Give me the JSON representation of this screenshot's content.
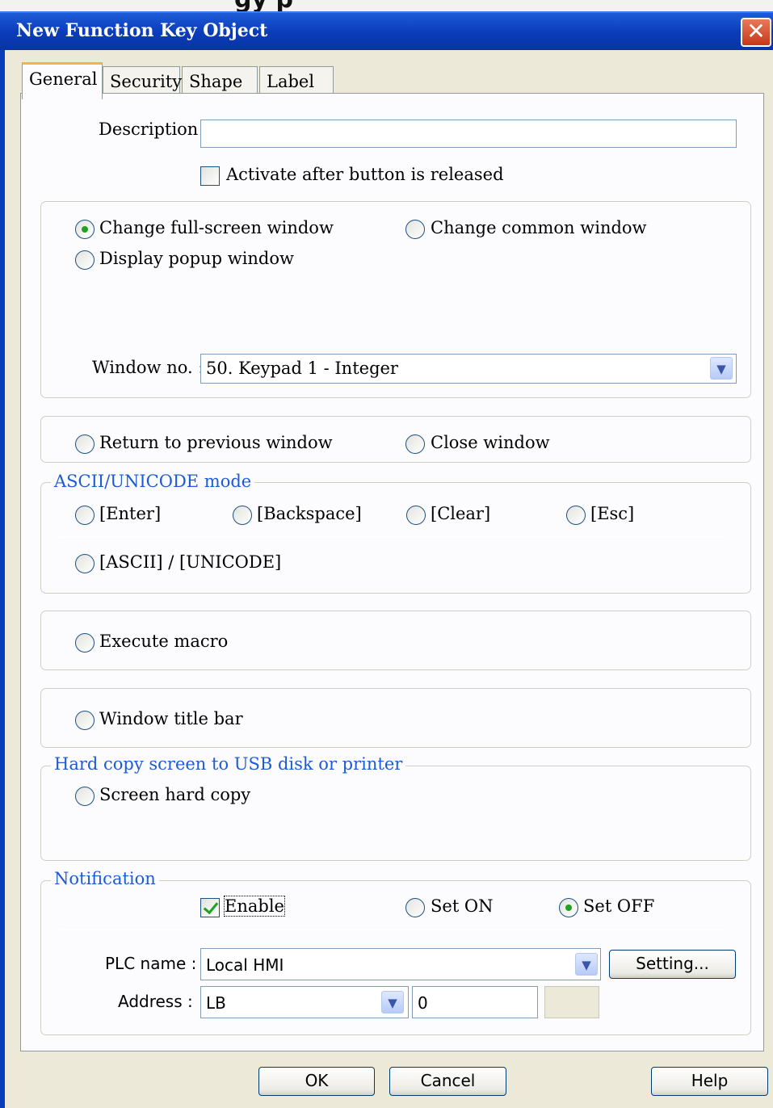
{
  "window": {
    "title": "New  Function Key Object",
    "close_icon": "close-icon",
    "top_strip_text": "gy p"
  },
  "tabs": [
    {
      "label": "General",
      "active": true
    },
    {
      "label": "Security",
      "active": false
    },
    {
      "label": "Shape",
      "active": false
    },
    {
      "label": "Label",
      "active": false
    }
  ],
  "general": {
    "description_label": "Description :",
    "description_value": "",
    "activate_after_release_label": "Activate after button is released",
    "activate_after_release_checked": false
  },
  "window_group": {
    "change_fullscreen_label": "Change full-screen window",
    "change_common_label": "Change common window",
    "display_popup_label": "Display popup window",
    "selected": "Change full-screen window",
    "window_no_label": "Window no. :",
    "window_no_value": "50. Keypad 1 - Integer"
  },
  "return_group": {
    "return_previous_label": "Return to previous window",
    "close_window_label": "Close window"
  },
  "ascii_group": {
    "legend": "ASCII/UNICODE mode",
    "enter_label": "[Enter]",
    "backspace_label": "[Backspace]",
    "clear_label": "[Clear]",
    "esc_label": "[Esc]",
    "ascii_unicode_label": "[ASCII] / [UNICODE]"
  },
  "macro_group": {
    "execute_macro_label": "Execute macro"
  },
  "titlebar_group": {
    "window_title_bar_label": "Window title bar"
  },
  "hardcopy_group": {
    "legend": "Hard copy screen to USB disk or printer",
    "screen_hard_copy_label": "Screen hard copy"
  },
  "notification": {
    "legend": "Notification",
    "enable_label": "Enable",
    "enable_checked": true,
    "set_on_label": "Set ON",
    "set_off_label": "Set OFF",
    "selected": "Set OFF",
    "plc_name_label": "PLC name :",
    "plc_name_value": "Local HMI",
    "setting_button": "Setting...",
    "address_label": "Address :",
    "address_device_value": "LB",
    "address_value": "0"
  },
  "footer": {
    "ok": "OK",
    "cancel": "Cancel",
    "help": "Help"
  },
  "colors": {
    "titlebar": "#0a3bb8",
    "legend_text": "#1c5cd2",
    "active_tab_accent": "#f3b63b",
    "radio_dot": "#21a121"
  }
}
